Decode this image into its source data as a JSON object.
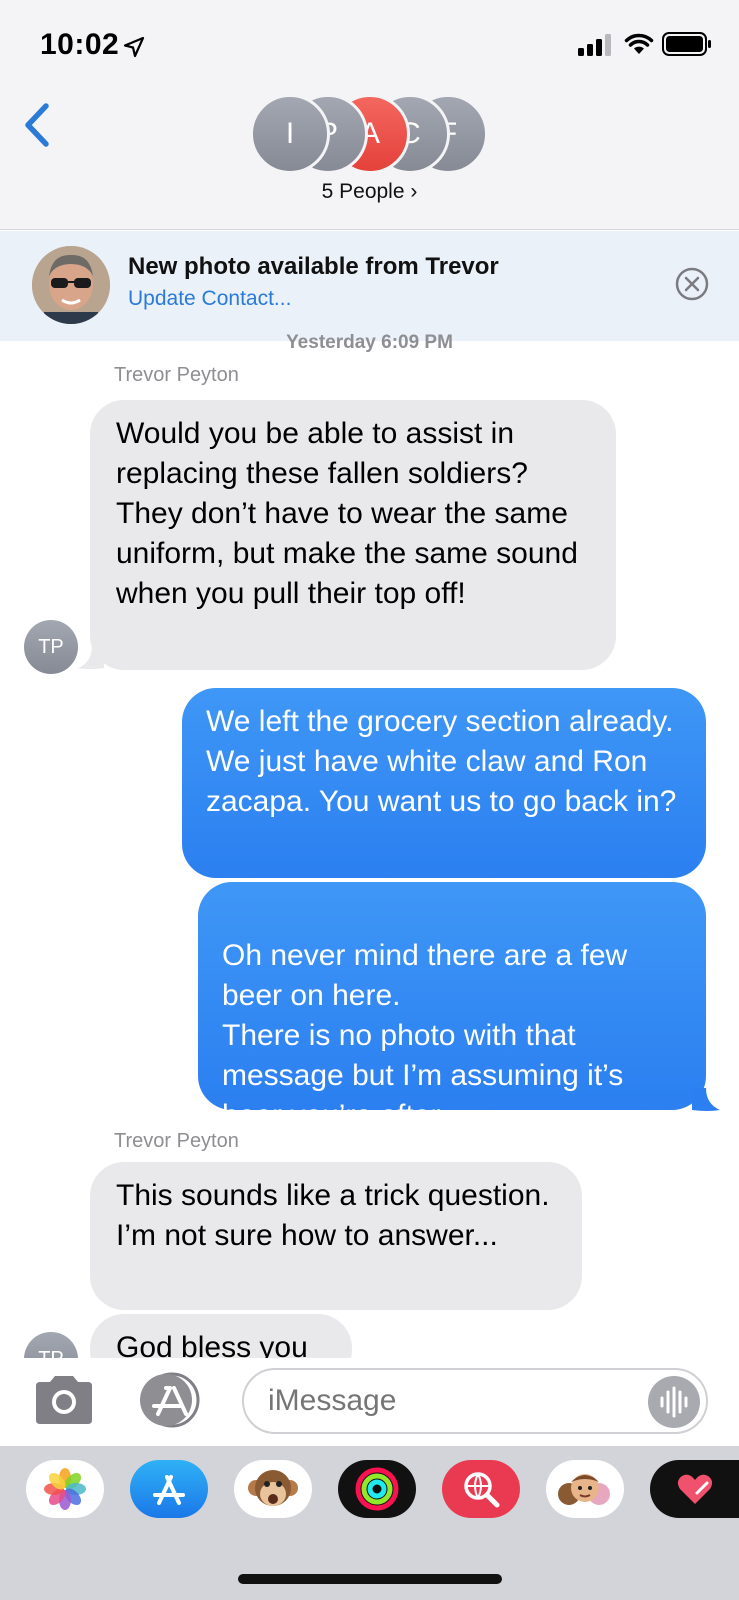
{
  "status_bar": {
    "time": "10:02"
  },
  "header": {
    "group_initials": [
      "I",
      "P",
      "A",
      "C",
      "F"
    ],
    "people_label": "5 People ›"
  },
  "banner": {
    "title": "New photo available from Trevor",
    "link": "Update Contact..."
  },
  "conversation": {
    "timestamp": "Yesterday 6:09 PM",
    "messages": [
      {
        "sender": "Trevor Peyton",
        "direction": "incoming",
        "text": "Would you be able to assist in replacing these fallen soldiers? They don’t have to wear the same uniform, but make the same sound when you pull their top off!"
      },
      {
        "direction": "outgoing",
        "text": "We left the grocery section already. We just have white claw and Ron zacapa. You want us to go back in?"
      },
      {
        "direction": "outgoing",
        "text": "Oh never mind there are a few beer on here.\nThere is no photo with that message but I’m assuming it’s beer you’re after."
      },
      {
        "sender": "Trevor Peyton",
        "direction": "incoming",
        "text": "This sounds like a trick question. I’m not sure how to answer..."
      },
      {
        "direction": "incoming",
        "text": "God bless you"
      }
    ],
    "avatar_initials": "TP"
  },
  "input": {
    "placeholder": "iMessage"
  },
  "colors": {
    "outgoing_bubble": "#2b7ff0",
    "incoming_bubble": "#e9e9eb",
    "link_blue": "#2a7ad8",
    "header_bg": "#f4f4f6",
    "group_avatar_gray": "#8e929c",
    "group_avatar_accent": "#f0524a"
  },
  "app_drawer": {
    "apps": [
      "photos-app-icon",
      "app-store-icon",
      "animoji-icon",
      "activity-icon",
      "web-images-search-icon",
      "memoji-stickers-icon",
      "digital-touch-icon"
    ]
  }
}
